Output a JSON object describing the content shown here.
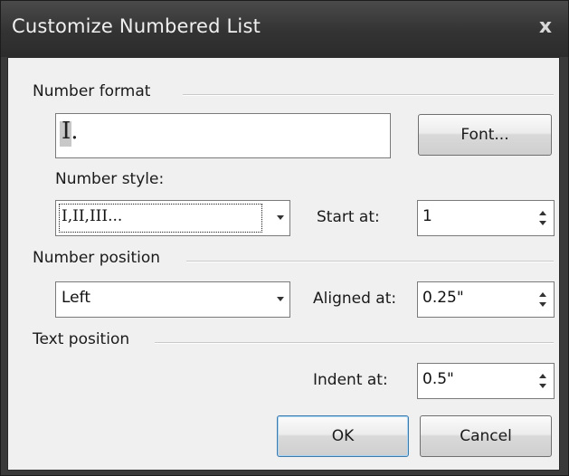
{
  "dialog": {
    "title": "Customize Numbered List",
    "close_glyph": "x"
  },
  "number_format": {
    "section_label": "Number format",
    "format_value": "I.",
    "font_button_label": "Font...",
    "style_label": "Number style:",
    "style_value": "I,II,III...",
    "start_at_label": "Start at:",
    "start_at_value": "1"
  },
  "number_position": {
    "section_label": "Number position",
    "alignment_value": "Left",
    "aligned_at_label": "Aligned at:",
    "aligned_at_value": "0.25\""
  },
  "text_position": {
    "section_label": "Text position",
    "indent_at_label": "Indent at:",
    "indent_at_value": "0.5\""
  },
  "buttons": {
    "ok_label": "OK",
    "cancel_label": "Cancel"
  },
  "icons": {
    "close": "close-icon",
    "dropdown": "chevron-down-icon",
    "spin_up": "spin-up-icon",
    "spin_down": "spin-down-icon"
  }
}
